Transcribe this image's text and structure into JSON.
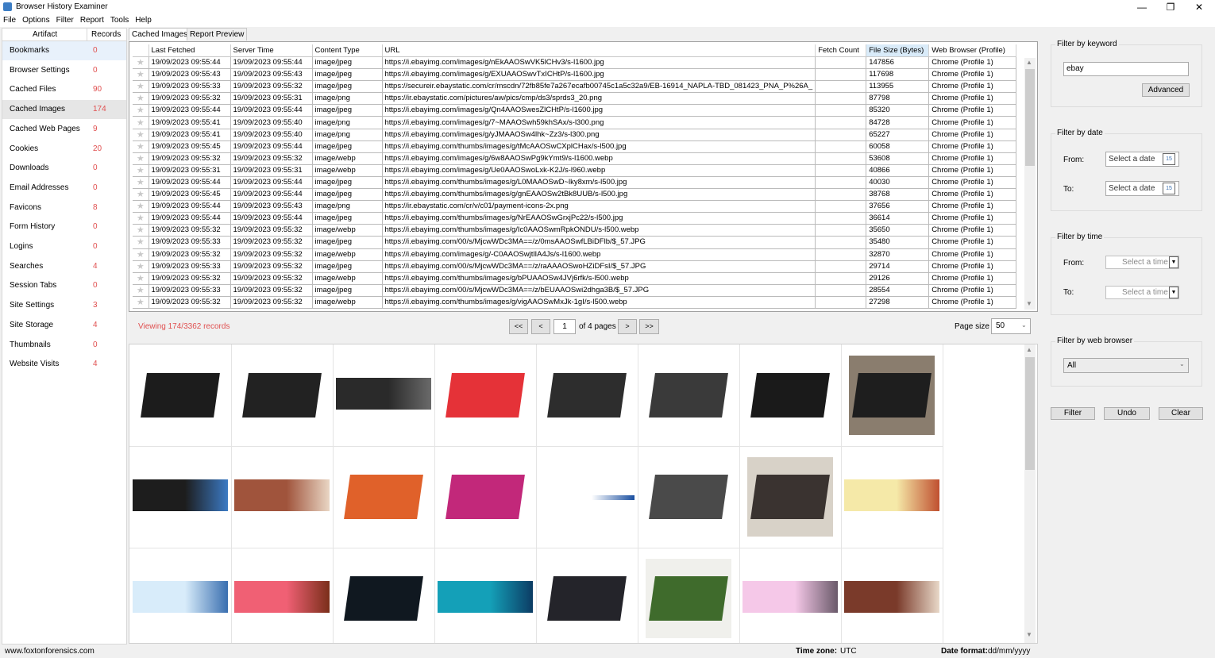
{
  "window": {
    "title": "Browser History Examiner",
    "minimize": "—",
    "restore": "❐",
    "close": "✕"
  },
  "menu": [
    "File",
    "Options",
    "Filter",
    "Report",
    "Tools",
    "Help"
  ],
  "artifacts": {
    "col_artifact": "Artifact",
    "col_records": "Records",
    "items": [
      {
        "name": "Bookmarks",
        "count": "0"
      },
      {
        "name": "Browser Settings",
        "count": "0"
      },
      {
        "name": "Cached Files",
        "count": "90"
      },
      {
        "name": "Cached Images",
        "count": "174"
      },
      {
        "name": "Cached Web Pages",
        "count": "9"
      },
      {
        "name": "Cookies",
        "count": "20"
      },
      {
        "name": "Downloads",
        "count": "0"
      },
      {
        "name": "Email Addresses",
        "count": "0"
      },
      {
        "name": "Favicons",
        "count": "8"
      },
      {
        "name": "Form History",
        "count": "0"
      },
      {
        "name": "Logins",
        "count": "0"
      },
      {
        "name": "Searches",
        "count": "4"
      },
      {
        "name": "Session Tabs",
        "count": "0"
      },
      {
        "name": "Site Settings",
        "count": "3"
      },
      {
        "name": "Site Storage",
        "count": "4"
      },
      {
        "name": "Thumbnails",
        "count": "0"
      },
      {
        "name": "Website Visits",
        "count": "4"
      }
    ]
  },
  "tabs": [
    "Cached Images",
    "Report Preview"
  ],
  "grid": {
    "columns": [
      "",
      "Last Fetched",
      "Server Time",
      "Content Type",
      "URL",
      "Fetch Count",
      "File Size (Bytes)",
      "Web Browser (Profile)"
    ],
    "rows": [
      [
        "19/09/2023 09:55:44",
        "19/09/2023 09:55:44",
        "image/jpeg",
        "https://i.ebayimg.com/images/g/nEkAAOSwVK5lCHv3/s-l1600.jpg",
        "",
        "147856",
        "Chrome (Profile 1)"
      ],
      [
        "19/09/2023 09:55:43",
        "19/09/2023 09:55:43",
        "image/jpeg",
        "https://i.ebayimg.com/images/g/EXUAAOSwvTxICHtP/s-l1600.jpg",
        "",
        "117698",
        "Chrome (Profile 1)"
      ],
      [
        "19/09/2023 09:55:33",
        "19/09/2023 09:55:32",
        "image/jpeg",
        "https://secureir.ebaystatic.com/cr/mscdn/72fb85fe7a267ecafb00745c1a5c32a9/EB-16914_NAPLA-TBD_081423_PNA_P%26A_",
        "",
        "113955",
        "Chrome (Profile 1)"
      ],
      [
        "19/09/2023 09:55:32",
        "19/09/2023 09:55:31",
        "image/png",
        "https://ir.ebaystatic.com/pictures/aw/pics/cmp/ds3/sprds3_20.png",
        "",
        "87798",
        "Chrome (Profile 1)"
      ],
      [
        "19/09/2023 09:55:44",
        "19/09/2023 09:55:44",
        "image/jpeg",
        "https://i.ebayimg.com/images/g/Qn4AAOSwesZlCHtP/s-l1600.jpg",
        "",
        "85320",
        "Chrome (Profile 1)"
      ],
      [
        "19/09/2023 09:55:41",
        "19/09/2023 09:55:40",
        "image/png",
        "https://i.ebayimg.com/images/g/7~MAAOSwh59khSAx/s-l300.png",
        "",
        "84728",
        "Chrome (Profile 1)"
      ],
      [
        "19/09/2023 09:55:41",
        "19/09/2023 09:55:40",
        "image/png",
        "https://i.ebayimg.com/images/g/yJMAAOSw4lhk~Zz3/s-l300.png",
        "",
        "65227",
        "Chrome (Profile 1)"
      ],
      [
        "19/09/2023 09:55:45",
        "19/09/2023 09:55:44",
        "image/jpeg",
        "https://i.ebayimg.com/thumbs/images/g/tMcAAOSwCXplCHax/s-l500.jpg",
        "",
        "60058",
        "Chrome (Profile 1)"
      ],
      [
        "19/09/2023 09:55:32",
        "19/09/2023 09:55:32",
        "image/webp",
        "https://i.ebayimg.com/images/g/6w8AAOSwPg9kYmt9/s-l1600.webp",
        "",
        "53608",
        "Chrome (Profile 1)"
      ],
      [
        "19/09/2023 09:55:31",
        "19/09/2023 09:55:31",
        "image/webp",
        "https://i.ebayimg.com/images/g/Ue0AAOSwoLxk-K2J/s-l960.webp",
        "",
        "40866",
        "Chrome (Profile 1)"
      ],
      [
        "19/09/2023 09:55:44",
        "19/09/2023 09:55:44",
        "image/jpeg",
        "https://i.ebayimg.com/thumbs/images/g/L0MAAOSwD~lky8xm/s-l500.jpg",
        "",
        "40030",
        "Chrome (Profile 1)"
      ],
      [
        "19/09/2023 09:55:45",
        "19/09/2023 09:55:44",
        "image/jpeg",
        "https://i.ebayimg.com/thumbs/images/g/gnEAAOSw2tBk8UUB/s-l500.jpg",
        "",
        "38768",
        "Chrome (Profile 1)"
      ],
      [
        "19/09/2023 09:55:44",
        "19/09/2023 09:55:43",
        "image/png",
        "https://ir.ebaystatic.com/cr/v/c01/payment-icons-2x.png",
        "",
        "37656",
        "Chrome (Profile 1)"
      ],
      [
        "19/09/2023 09:55:44",
        "19/09/2023 09:55:44",
        "image/jpeg",
        "https://i.ebayimg.com/thumbs/images/g/NrEAAOSwGrxjPc22/s-l500.jpg",
        "",
        "36614",
        "Chrome (Profile 1)"
      ],
      [
        "19/09/2023 09:55:32",
        "19/09/2023 09:55:32",
        "image/webp",
        "https://i.ebayimg.com/thumbs/images/g/Ic0AAOSwmRpkONDU/s-l500.webp",
        "",
        "35650",
        "Chrome (Profile 1)"
      ],
      [
        "19/09/2023 09:55:33",
        "19/09/2023 09:55:32",
        "image/jpeg",
        "https://i.ebayimg.com/00/s/MjcwWDc3MA==/z/0msAAOSwfLBiDFlb/$_57.JPG",
        "",
        "35480",
        "Chrome (Profile 1)"
      ],
      [
        "19/09/2023 09:55:32",
        "19/09/2023 09:55:32",
        "image/webp",
        "https://i.ebayimg.com/images/g/-C0AAOSwjtlIA4Js/s-l1600.webp",
        "",
        "32870",
        "Chrome (Profile 1)"
      ],
      [
        "19/09/2023 09:55:33",
        "19/09/2023 09:55:32",
        "image/jpeg",
        "https://i.ebayimg.com/00/s/MjcwWDc3MA==/z/raAAAOSwoHZiDFsI/$_57.JPG",
        "",
        "29714",
        "Chrome (Profile 1)"
      ],
      [
        "19/09/2023 09:55:32",
        "19/09/2023 09:55:32",
        "image/webp",
        "https://i.ebayimg.com/thumbs/images/g/bPUAAOSw4JVj6rfk/s-l500.webp",
        "",
        "29126",
        "Chrome (Profile 1)"
      ],
      [
        "19/09/2023 09:55:33",
        "19/09/2023 09:55:32",
        "image/jpeg",
        "https://i.ebayimg.com/00/s/MjcwWDc3MA==/z/bEUAAOSwi2dhga3B/$_57.JPG",
        "",
        "28554",
        "Chrome (Profile 1)"
      ],
      [
        "19/09/2023 09:55:32",
        "19/09/2023 09:55:32",
        "image/webp",
        "https://i.ebayimg.com/thumbs/images/g/vigAAOSwMxJk-1gI/s-l500.webp",
        "",
        "27298",
        "Chrome (Profile 1)"
      ]
    ]
  },
  "pager": {
    "viewing": "Viewing 174/3362 records",
    "first": "<<",
    "prev": "<",
    "page": "1",
    "of_pages": "of 4 pages",
    "next": ">",
    "last": ">>",
    "page_size_label": "Page size",
    "page_size": "50"
  },
  "gallery": {
    "images": [
      {
        "name": "laptop-thinkpad-photo",
        "bg": "#fff",
        "fg": "#1c1c1c"
      },
      {
        "name": "laptop-thinkpad-dark-photo",
        "bg": "#fff",
        "fg": "#222"
      },
      {
        "name": "ebay-parts-banner",
        "bg": "#2a2a2a",
        "fg": "#6a6a6a"
      },
      {
        "name": "ebay-sprite-sheet",
        "bg": "#fff",
        "fg": "#e53238"
      },
      {
        "name": "laptop-screen-photo",
        "bg": "#fff",
        "fg": "#2d2d2d"
      },
      {
        "name": "laptops-hp-photo",
        "bg": "#fff",
        "fg": "#3a3a3a"
      },
      {
        "name": "laptop-wallpaper-photo",
        "bg": "#fff",
        "fg": "#1a1a1a"
      },
      {
        "name": "laptop-desk-photo",
        "bg": "#8a7d6e",
        "fg": "#1e1e1e"
      },
      {
        "name": "tyres-banner",
        "bg": "#1d1d1d",
        "fg": "#3b7ac4"
      },
      {
        "name": "bedroom-banner",
        "bg": "#a0543c",
        "fg": "#e9d6c4"
      },
      {
        "name": "laptop-orange-screen-photo",
        "bg": "#fff",
        "fg": "#e0612a"
      },
      {
        "name": "laptop-magenta-photo",
        "bg": "#fff",
        "fg": "#c2287a"
      },
      {
        "name": "payment-icons-strip",
        "bg": "#fff",
        "fg": "#1a4fa0"
      },
      {
        "name": "laptop-silver-photo",
        "bg": "#fff",
        "fg": "#4a4a4a"
      },
      {
        "name": "bar-stools-photo",
        "bg": "#d8d2c8",
        "fg": "#3a3330"
      },
      {
        "name": "collectibles-banner",
        "bg": "#f5e9a8",
        "fg": "#c05030"
      },
      {
        "name": "tech-banner",
        "bg": "#d8ecfa",
        "fg": "#3a6fb0"
      },
      {
        "name": "toys-banner",
        "bg": "#f06074",
        "fg": "#7a2f1a"
      },
      {
        "name": "playstation-photo",
        "bg": "#fff",
        "fg": "#101820"
      },
      {
        "name": "refurbished-banner",
        "bg": "#14a0b8",
        "fg": "#0c3c64"
      },
      {
        "name": "ipad-photo",
        "bg": "#fff",
        "fg": "#24242a"
      },
      {
        "name": "wreath-photo",
        "bg": "#f0f0ec",
        "fg": "#3f6b2c"
      },
      {
        "name": "home-garden-banner",
        "bg": "#f5c8e8",
        "fg": "#6a5a6a"
      },
      {
        "name": "fashion-banner",
        "bg": "#7a3a2a",
        "fg": "#e8d8c8"
      }
    ]
  },
  "filters": {
    "keyword": {
      "label": "Filter by keyword",
      "value": "ebay",
      "advanced": "Advanced"
    },
    "date": {
      "label": "Filter by date",
      "from": "From:",
      "to": "To:",
      "placeholder": "Select a date",
      "cal": "15"
    },
    "time": {
      "label": "Filter by time",
      "from": "From:",
      "to": "To:",
      "placeholder": "Select a time"
    },
    "browser": {
      "label": "Filter by web browser",
      "value": "All"
    },
    "buttons": {
      "filter": "Filter",
      "undo": "Undo",
      "clear": "Clear"
    }
  },
  "status": {
    "website": "www.foxtonforensics.com",
    "timezone_label": "Time zone:",
    "timezone": "UTC",
    "dateformat_label": "Date format:",
    "dateformat": "dd/mm/yyyy"
  },
  "colors": {
    "accent": "#0078d7",
    "count_red": "#e05050",
    "selected_row": "#e6e6e6"
  }
}
